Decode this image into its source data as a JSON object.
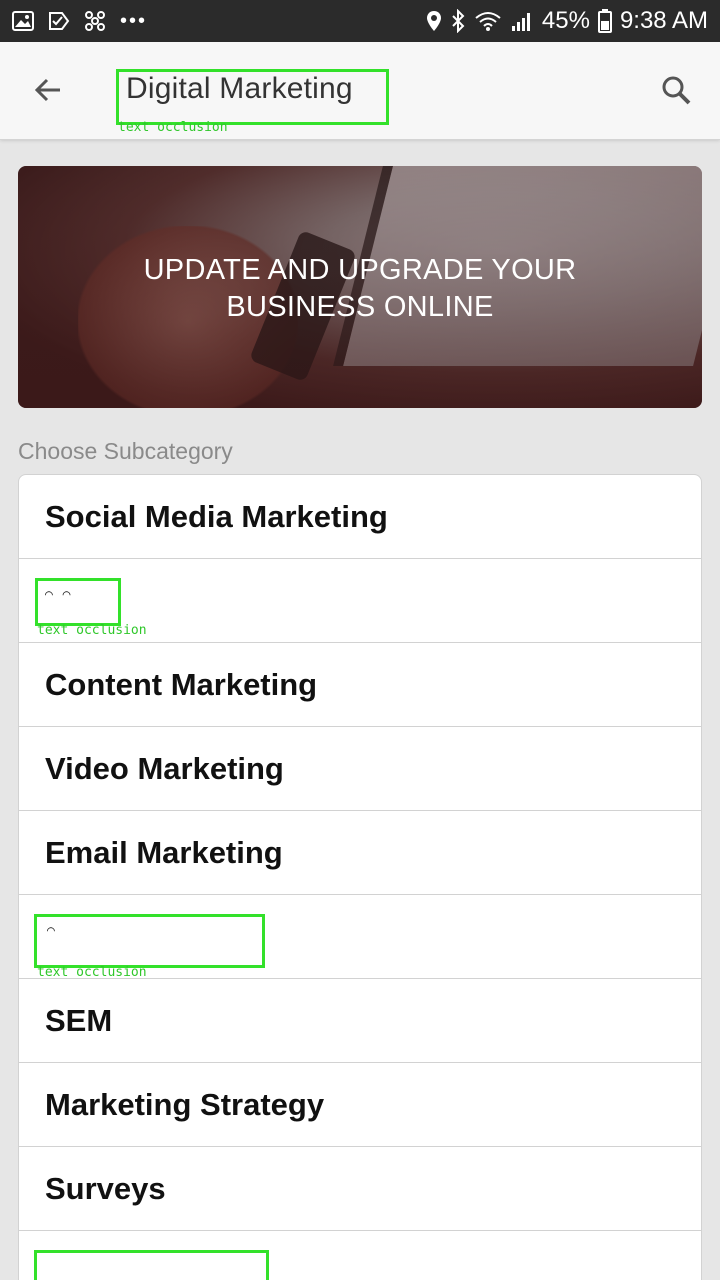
{
  "status_bar": {
    "battery": "45%",
    "time": "9:38 AM",
    "icons": [
      "image-icon",
      "task-icon",
      "fan-icon",
      "more-dots-icon",
      "location-icon",
      "bluetooth-icon",
      "wifi-icon",
      "signal-icon",
      "battery-icon"
    ]
  },
  "app_bar": {
    "title": "Digital Marketing",
    "occlusion_label": "text occlusion",
    "back_icon": "arrow-left-icon",
    "search_icon": "search-icon"
  },
  "banner": {
    "line1": "UPDATE AND UPGRADE YOUR",
    "line2": "BUSINESS ONLINE"
  },
  "section_label": "Choose Subcategory",
  "subcategories": [
    {
      "label": "Social Media Marketing",
      "occluded": false
    },
    {
      "label": "",
      "occluded": true,
      "occlusion_label": "text occlusion"
    },
    {
      "label": "Content Marketing",
      "occluded": false
    },
    {
      "label": "Video Marketing",
      "occluded": false
    },
    {
      "label": "Email Marketing",
      "occluded": false
    },
    {
      "label": "",
      "occluded": true,
      "occlusion_label": "text occlusion"
    },
    {
      "label": "SEM",
      "occluded": false
    },
    {
      "label": "Marketing Strategy",
      "occluded": false
    },
    {
      "label": "Surveys",
      "occluded": false
    },
    {
      "label": "",
      "occluded": true
    }
  ],
  "colors": {
    "status_bar_bg": "#2b2b2b",
    "app_bar_bg": "#f7f7f7",
    "page_bg": "#e6e6e6",
    "occlusion_outline": "#33e12a"
  }
}
